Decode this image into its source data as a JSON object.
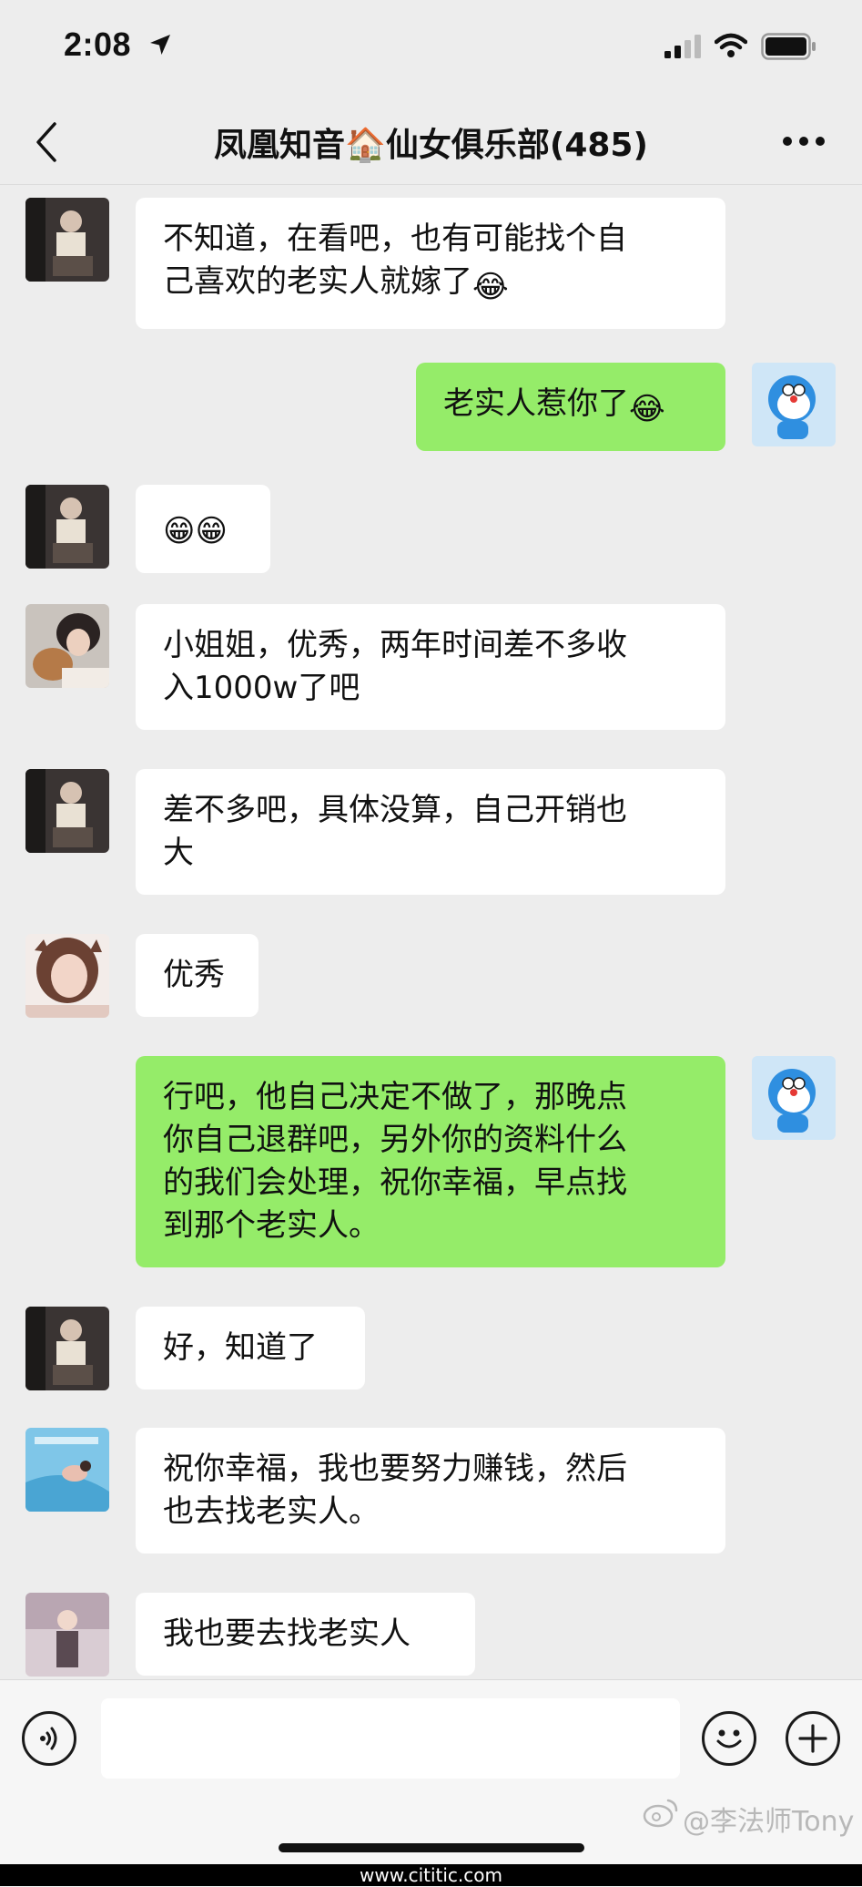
{
  "status_bar": {
    "time": "2:08"
  },
  "nav": {
    "title": "凤凰知音🏠仙女俱乐部(485)"
  },
  "messages": [
    {
      "lines": [
        "不知道，在看吧，也有可能找个自",
        "己喜欢的老实人就嫁了"
      ],
      "emoji": "😂"
    },
    {
      "lines": [
        "老实人惹你了"
      ],
      "emoji": "😂"
    },
    {
      "lines": [
        ""
      ],
      "emoji": "😁😁"
    },
    {
      "lines": [
        "小姐姐，优秀，两年时间差不多收",
        "入1000w了吧"
      ]
    },
    {
      "lines": [
        "差不多吧，具体没算，自己开销也",
        "大"
      ]
    },
    {
      "lines": [
        "优秀"
      ]
    },
    {
      "lines": [
        "行吧，他自己决定不做了，那晚点",
        "你自己退群吧，另外你的资料什么",
        "的我们会处理，祝你幸福，早点找",
        "到那个老实人。"
      ]
    },
    {
      "lines": [
        "好，知道了"
      ]
    },
    {
      "lines": [
        "祝你幸福，我也要努力赚钱，然后",
        "也去找老实人。"
      ]
    },
    {
      "lines": [
        "我也要去找老实人"
      ]
    }
  ],
  "input": {
    "placeholder": ""
  },
  "watermark": "@李法师Tony",
  "footer": "www.cititic.com",
  "colors": {
    "incoming_bubble": "#ffffff",
    "outgoing_bubble": "#95ec69",
    "background": "#ededed"
  }
}
